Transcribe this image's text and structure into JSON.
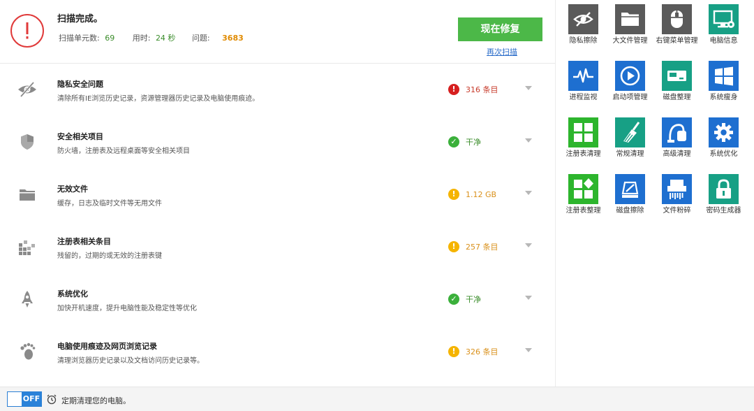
{
  "summary": {
    "title": "扫描完成。",
    "units_label": "扫描单元数:",
    "units_value": "69",
    "time_label": "用时:",
    "time_value": "24 秒",
    "issues_label": "问题:",
    "issues_value": "3683",
    "fix_button": "现在修复",
    "rescan_link": "再次扫描"
  },
  "items": [
    {
      "icon": "eye-slash-icon",
      "title": "隐私安全问题",
      "desc": "清除所有IE浏览历史记录，资源管理器历史记录及电脑使用痕迹。",
      "status_type": "red",
      "status_mark": "!",
      "status_text": "316 条目"
    },
    {
      "icon": "shield-icon",
      "title": "安全相关项目",
      "desc": "防火墙，注册表及远程桌面等安全相关项目",
      "status_type": "green",
      "status_mark": "✓",
      "status_text": "干净"
    },
    {
      "icon": "folder-icon",
      "title": "无效文件",
      "desc": "缓存，日志及临时文件等无用文件",
      "status_type": "yellow",
      "status_mark": "!",
      "status_text": "1.12 GB"
    },
    {
      "icon": "registry-blocks-icon",
      "title": "注册表相关条目",
      "desc": "残留的，过期的或无效的注册表键",
      "status_type": "yellow",
      "status_mark": "!",
      "status_text": "257 条目"
    },
    {
      "icon": "rocket-icon",
      "title": "系统优化",
      "desc": "加快开机速度，提升电脑性能及稳定性等优化",
      "status_type": "green",
      "status_mark": "✓",
      "status_text": "干净"
    },
    {
      "icon": "footprint-icon",
      "title": "电脑使用痕迹及网页浏览记录",
      "desc": "清理浏览器历史记录以及文档访问历史记录等。",
      "status_type": "yellow",
      "status_mark": "!",
      "status_text": "326 条目"
    }
  ],
  "tools": [
    {
      "label": "隐私擦除",
      "icon": "privacy-eraser-icon",
      "color": "#5a5a5a"
    },
    {
      "label": "大文件管理",
      "icon": "folder-icon",
      "color": "#5a5a5a"
    },
    {
      "label": "右键菜单管理",
      "icon": "mouse-icon",
      "color": "#5a5a5a"
    },
    {
      "label": "电脑信息",
      "icon": "computer-info-icon",
      "color": "#17a085"
    },
    {
      "label": "进程监视",
      "icon": "pulse-icon",
      "color": "#1e6fd0"
    },
    {
      "label": "启动项管理",
      "icon": "play-icon",
      "color": "#1e6fd0"
    },
    {
      "label": "磁盘整理",
      "icon": "disk-icon",
      "color": "#17a085"
    },
    {
      "label": "系统瘦身",
      "icon": "windows-icon",
      "color": "#1e6fd0"
    },
    {
      "label": "注册表清理",
      "icon": "grid-icon",
      "color": "#2db52d"
    },
    {
      "label": "常规清理",
      "icon": "broom-icon",
      "color": "#17a085"
    },
    {
      "label": "高级清理",
      "icon": "vacuum-icon",
      "color": "#1e6fd0"
    },
    {
      "label": "系统优化",
      "icon": "gear-icon",
      "color": "#1e6fd0"
    },
    {
      "label": "注册表整理",
      "icon": "registry-defrag-icon",
      "color": "#2db52d"
    },
    {
      "label": "磁盘擦除",
      "icon": "disk-wipe-icon",
      "color": "#1e6fd0"
    },
    {
      "label": "文件粉碎",
      "icon": "shredder-icon",
      "color": "#1e6fd0"
    },
    {
      "label": "密码生成器",
      "icon": "lock-icon",
      "color": "#17a085"
    }
  ],
  "bottom": {
    "toggle_label": "OFF",
    "schedule_text": "定期清理您的电脑。"
  },
  "colors": {
    "fix_button": "#4cb848",
    "status_red": "#d61f1f",
    "status_green": "#3bb03b",
    "status_yellow": "#f5b400",
    "toggle_blue": "#2a82d9"
  }
}
